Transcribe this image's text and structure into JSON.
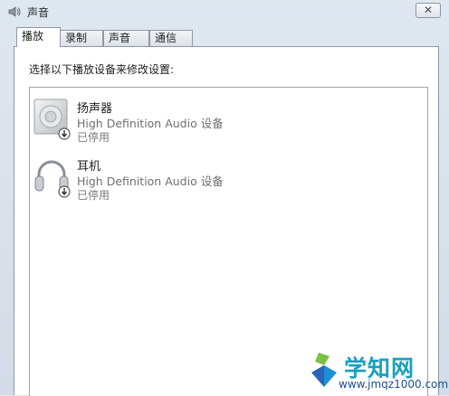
{
  "window": {
    "title": "声音",
    "icon": "speaker-icon",
    "close_label": "✕"
  },
  "tabs": [
    {
      "label": "播放",
      "active": true
    },
    {
      "label": "录制",
      "active": false
    },
    {
      "label": "声音",
      "active": false
    },
    {
      "label": "通信",
      "active": false
    }
  ],
  "panel": {
    "instruction": "选择以下播放设备来修改设置:"
  },
  "devices": [
    {
      "name": "扬声器",
      "description": "High Definition Audio 设备",
      "status": "已停用",
      "icon": "speaker-device-icon",
      "overlay_icon": "disabled-arrow-icon"
    },
    {
      "name": "耳机",
      "description": "High Definition Audio 设备",
      "status": "已停用",
      "icon": "headphones-icon",
      "overlay_icon": "disabled-arrow-icon"
    }
  ],
  "watermark": {
    "text": "学知网",
    "url": "www.jmqz1000.com"
  },
  "colors": {
    "window_bg": "#d8e1ec",
    "panel_bg": "#ffffff",
    "border": "#8e98a6",
    "desc_text": "#6f6f6f",
    "watermark_text": "#18a0c2"
  }
}
